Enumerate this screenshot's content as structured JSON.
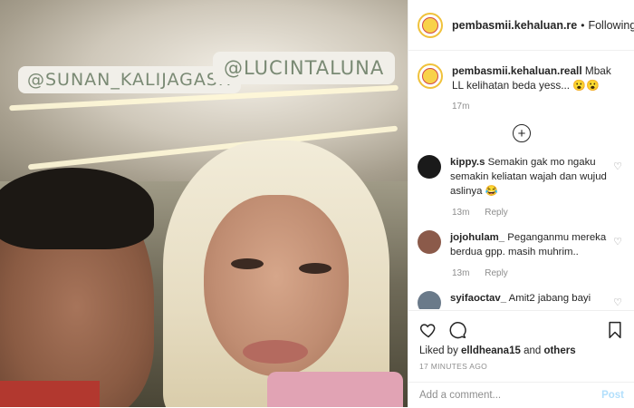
{
  "photo": {
    "tags": [
      "@SUNAN_KALIJAGASH",
      "@LUCINTALUNA"
    ]
  },
  "header": {
    "username": "pembasmii.kehaluan.re",
    "dot": "•",
    "follow_label": "Following"
  },
  "caption": {
    "username": "pembasmii.kehaluan.reall",
    "text": "Mbak LL kelihatan beda yess... 😮😮",
    "time": "17m"
  },
  "load_more_icon": "plus-circle-icon",
  "comments": [
    {
      "username": "kippy.s",
      "text": "Semakin gak mo ngaku semakin keliatan wajah dan wujud aslinya 😂",
      "time": "13m",
      "reply": "Reply",
      "avatar_color": "#1a1a1a"
    },
    {
      "username": "jojohulam_",
      "text": "Peganganmu mereka berdua gpp. masih muhrim..",
      "time": "13m",
      "reply": "Reply",
      "avatar_color": "#8b5a4a"
    },
    {
      "username": "syifaoctav_",
      "text": "Amit2 jabang bayi",
      "time": "",
      "reply": "",
      "avatar_color": "#6a7a8a"
    }
  ],
  "actions": {
    "icons": [
      "heart-icon",
      "comment-icon",
      "bookmark-icon"
    ],
    "liked_by_prefix": "Liked by ",
    "liked_by_user": "elldheana15",
    "liked_by_and": " and ",
    "liked_by_others": "others",
    "time_ago": "17 MINUTES AGO"
  },
  "add_comment": {
    "placeholder": "Add a comment...",
    "post_label": "Post"
  },
  "colors": {
    "link_blue": "#b2dffc",
    "muted": "#8e8e8e",
    "text": "#262626"
  }
}
